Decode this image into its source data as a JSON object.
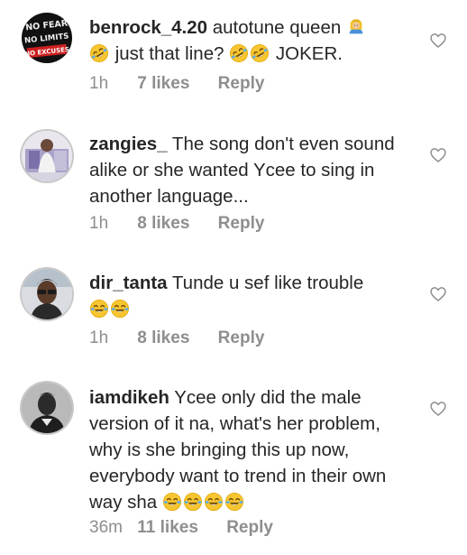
{
  "comments": [
    {
      "username": "benrock_4.20",
      "text_a": " autotune queen ",
      "text_b": " just that line? ",
      "text_c": " JOKER.",
      "time": "1h",
      "likes": "7 likes",
      "reply": "Reply",
      "avatar_lines": [
        "NO FEAR",
        "NO LIMITS",
        "NO EXCUSES"
      ]
    },
    {
      "username": "zangies_",
      "text": " The song don't even sound alike or she wanted Ycee to sing in another language...",
      "time": "1h",
      "likes": "8 likes",
      "reply": "Reply"
    },
    {
      "username": "dir_tanta",
      "text": " Tunde u sef like trouble",
      "time": "1h",
      "likes": "8 likes",
      "reply": "Reply"
    },
    {
      "username": "iamdikeh",
      "text": " Ycee only did the male version of it na, what's her problem, why is she bringing this up now, everybody want to trend in their own way sha ",
      "time": "36m",
      "likes": "11 likes",
      "reply": "Reply"
    }
  ],
  "icons": {
    "like": "heart-outline-icon",
    "emoji_queen": "queen-emoji-icon",
    "emoji_rofl": "rolling-laughing-emoji-icon",
    "emoji_joy": "tears-of-joy-emoji-icon"
  },
  "colors": {
    "text": "#262626",
    "meta": "#8e8e8e",
    "emoji": "#f7c531"
  }
}
